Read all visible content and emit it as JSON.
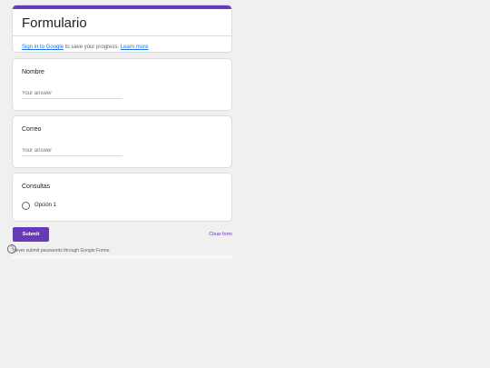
{
  "header": {
    "title": "Formulario",
    "signin_link": "Sign in to Google",
    "signin_text": " to save your progress. ",
    "learn_more": "Learn more"
  },
  "questions": [
    {
      "title": "Nombre",
      "placeholder": "Your answer"
    },
    {
      "title": "Correo",
      "placeholder": "Your answer"
    },
    {
      "title": "Consultas",
      "options": [
        "Opción 1"
      ]
    }
  ],
  "actions": {
    "submit_label": "Submit",
    "clear_label": "Clear form"
  },
  "footer": {
    "warning": "Never submit passwords through Google Forms."
  },
  "colors": {
    "accent": "#673ab7",
    "link": "#1a73e8",
    "background": "#f0f0f0"
  }
}
